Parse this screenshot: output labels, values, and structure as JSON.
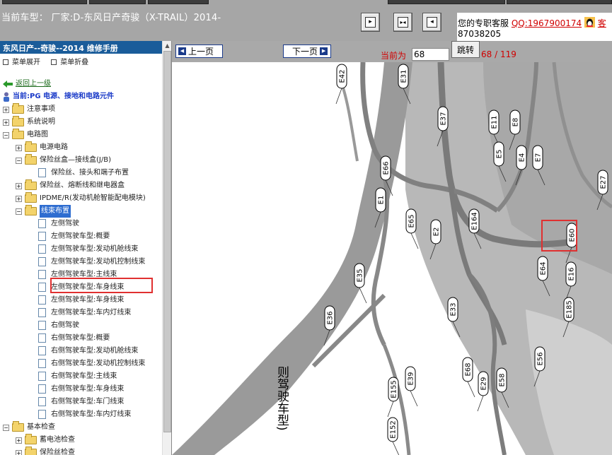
{
  "header": {
    "car_title": "当前车型：  厂家:D-东风日产奇骏（X-TRAIL）2014-",
    "nav_buttons": [
      {
        "name": "prev-page-nav",
        "glyph": "▸"
      },
      {
        "name": "fit-page-nav",
        "glyph": "▸◂"
      },
      {
        "name": "next-page-nav",
        "glyph": "◂"
      }
    ],
    "kefu": {
      "prefix": "您的专职客服",
      "qq": "QQ:1967900174",
      "suffix": "客",
      "line2": "87038205"
    }
  },
  "sidebar": {
    "manual_title": "东风日产--奇骏--2014 维修手册",
    "expand_label": "菜单展开",
    "collapse_label": "菜单折叠",
    "back_label": "返回上一级",
    "current_label": "当前:PG 电源、接地和电路元件",
    "tree": [
      {
        "label": "注意事项",
        "level": 0,
        "type": "folder",
        "toggle": "+"
      },
      {
        "label": "系统说明",
        "level": 0,
        "type": "folder",
        "toggle": "+"
      },
      {
        "label": "电路图",
        "level": 0,
        "type": "folder",
        "toggle": "-"
      },
      {
        "label": "电源电路",
        "level": 1,
        "type": "folder",
        "toggle": "+"
      },
      {
        "label": "保险丝盒—接线盒(J/B)",
        "level": 1,
        "type": "folder",
        "toggle": "-"
      },
      {
        "label": "保险丝、接头和端子布置",
        "level": 2,
        "type": "doc"
      },
      {
        "label": "保险丝、熔断线和继电器盒",
        "level": 1,
        "type": "folder",
        "toggle": "+"
      },
      {
        "label": "IPDME/R(发动机舱智能配电模块)",
        "level": 1,
        "type": "folder",
        "toggle": "+"
      },
      {
        "label": "线束布置",
        "level": 1,
        "type": "folder",
        "toggle": "-",
        "selected": true
      },
      {
        "label": "左侧驾驶",
        "level": 2,
        "type": "doc"
      },
      {
        "label": "左侧驾驶车型:概要",
        "level": 2,
        "type": "doc"
      },
      {
        "label": "左侧驾驶车型:发动机舱线束",
        "level": 2,
        "type": "doc"
      },
      {
        "label": "左侧驾驶车型:发动机控制线束",
        "level": 2,
        "type": "doc"
      },
      {
        "label": "左侧驾驶车型:主线束",
        "level": 2,
        "type": "doc"
      },
      {
        "label": "左侧驾驶车型:车身线束",
        "level": 2,
        "type": "doc"
      },
      {
        "label": "左侧驾驶车型:车身线束",
        "level": 2,
        "type": "doc"
      },
      {
        "label": "左侧驾驶车型:车内灯线束",
        "level": 2,
        "type": "doc"
      },
      {
        "label": "右侧驾驶",
        "level": 2,
        "type": "doc"
      },
      {
        "label": "右侧驾驶车型:概要",
        "level": 2,
        "type": "doc"
      },
      {
        "label": "右侧驾驶车型:发动机舱线束",
        "level": 2,
        "type": "doc"
      },
      {
        "label": "右侧驾驶车型:发动机控制线束",
        "level": 2,
        "type": "doc"
      },
      {
        "label": "右侧驾驶车型:主线束",
        "level": 2,
        "type": "doc"
      },
      {
        "label": "右侧驾驶车型:车身线束",
        "level": 2,
        "type": "doc"
      },
      {
        "label": "右侧驾驶车型:车门线束",
        "level": 2,
        "type": "doc"
      },
      {
        "label": "右侧驾驶车型:车内灯线束",
        "level": 2,
        "type": "doc"
      },
      {
        "label": "基本检查",
        "level": 0,
        "type": "folder",
        "toggle": "-"
      },
      {
        "label": "蓄电池检查",
        "level": 1,
        "type": "folder",
        "toggle": "+"
      },
      {
        "label": "保险丝检查",
        "level": 1,
        "type": "folder",
        "toggle": "+"
      }
    ]
  },
  "toolbar": {
    "prev_label": "上一页",
    "next_label": "下一页",
    "current_label": "当前为",
    "page_value": "68",
    "jump_label": "跳转",
    "page_count": "68 / 119"
  },
  "diagram": {
    "caption": "则驾驶车型)",
    "connectors": [
      "E42",
      "E31",
      "E37",
      "E11",
      "E8",
      "E5",
      "E4",
      "E7",
      "E27",
      "E66",
      "E1",
      "E65",
      "E2",
      "E164",
      "E60",
      "E64",
      "E16",
      "E35",
      "E185",
      "E33",
      "E36",
      "E68",
      "E29",
      "E58",
      "E56",
      "E39",
      "E155",
      "E152"
    ],
    "highlighted_connector": "E60"
  },
  "colors": {
    "highlight": "#e03030",
    "link_red": "#d00000",
    "title_blue": "#1a5c9a",
    "harness_gray": "#8a8a8a"
  }
}
